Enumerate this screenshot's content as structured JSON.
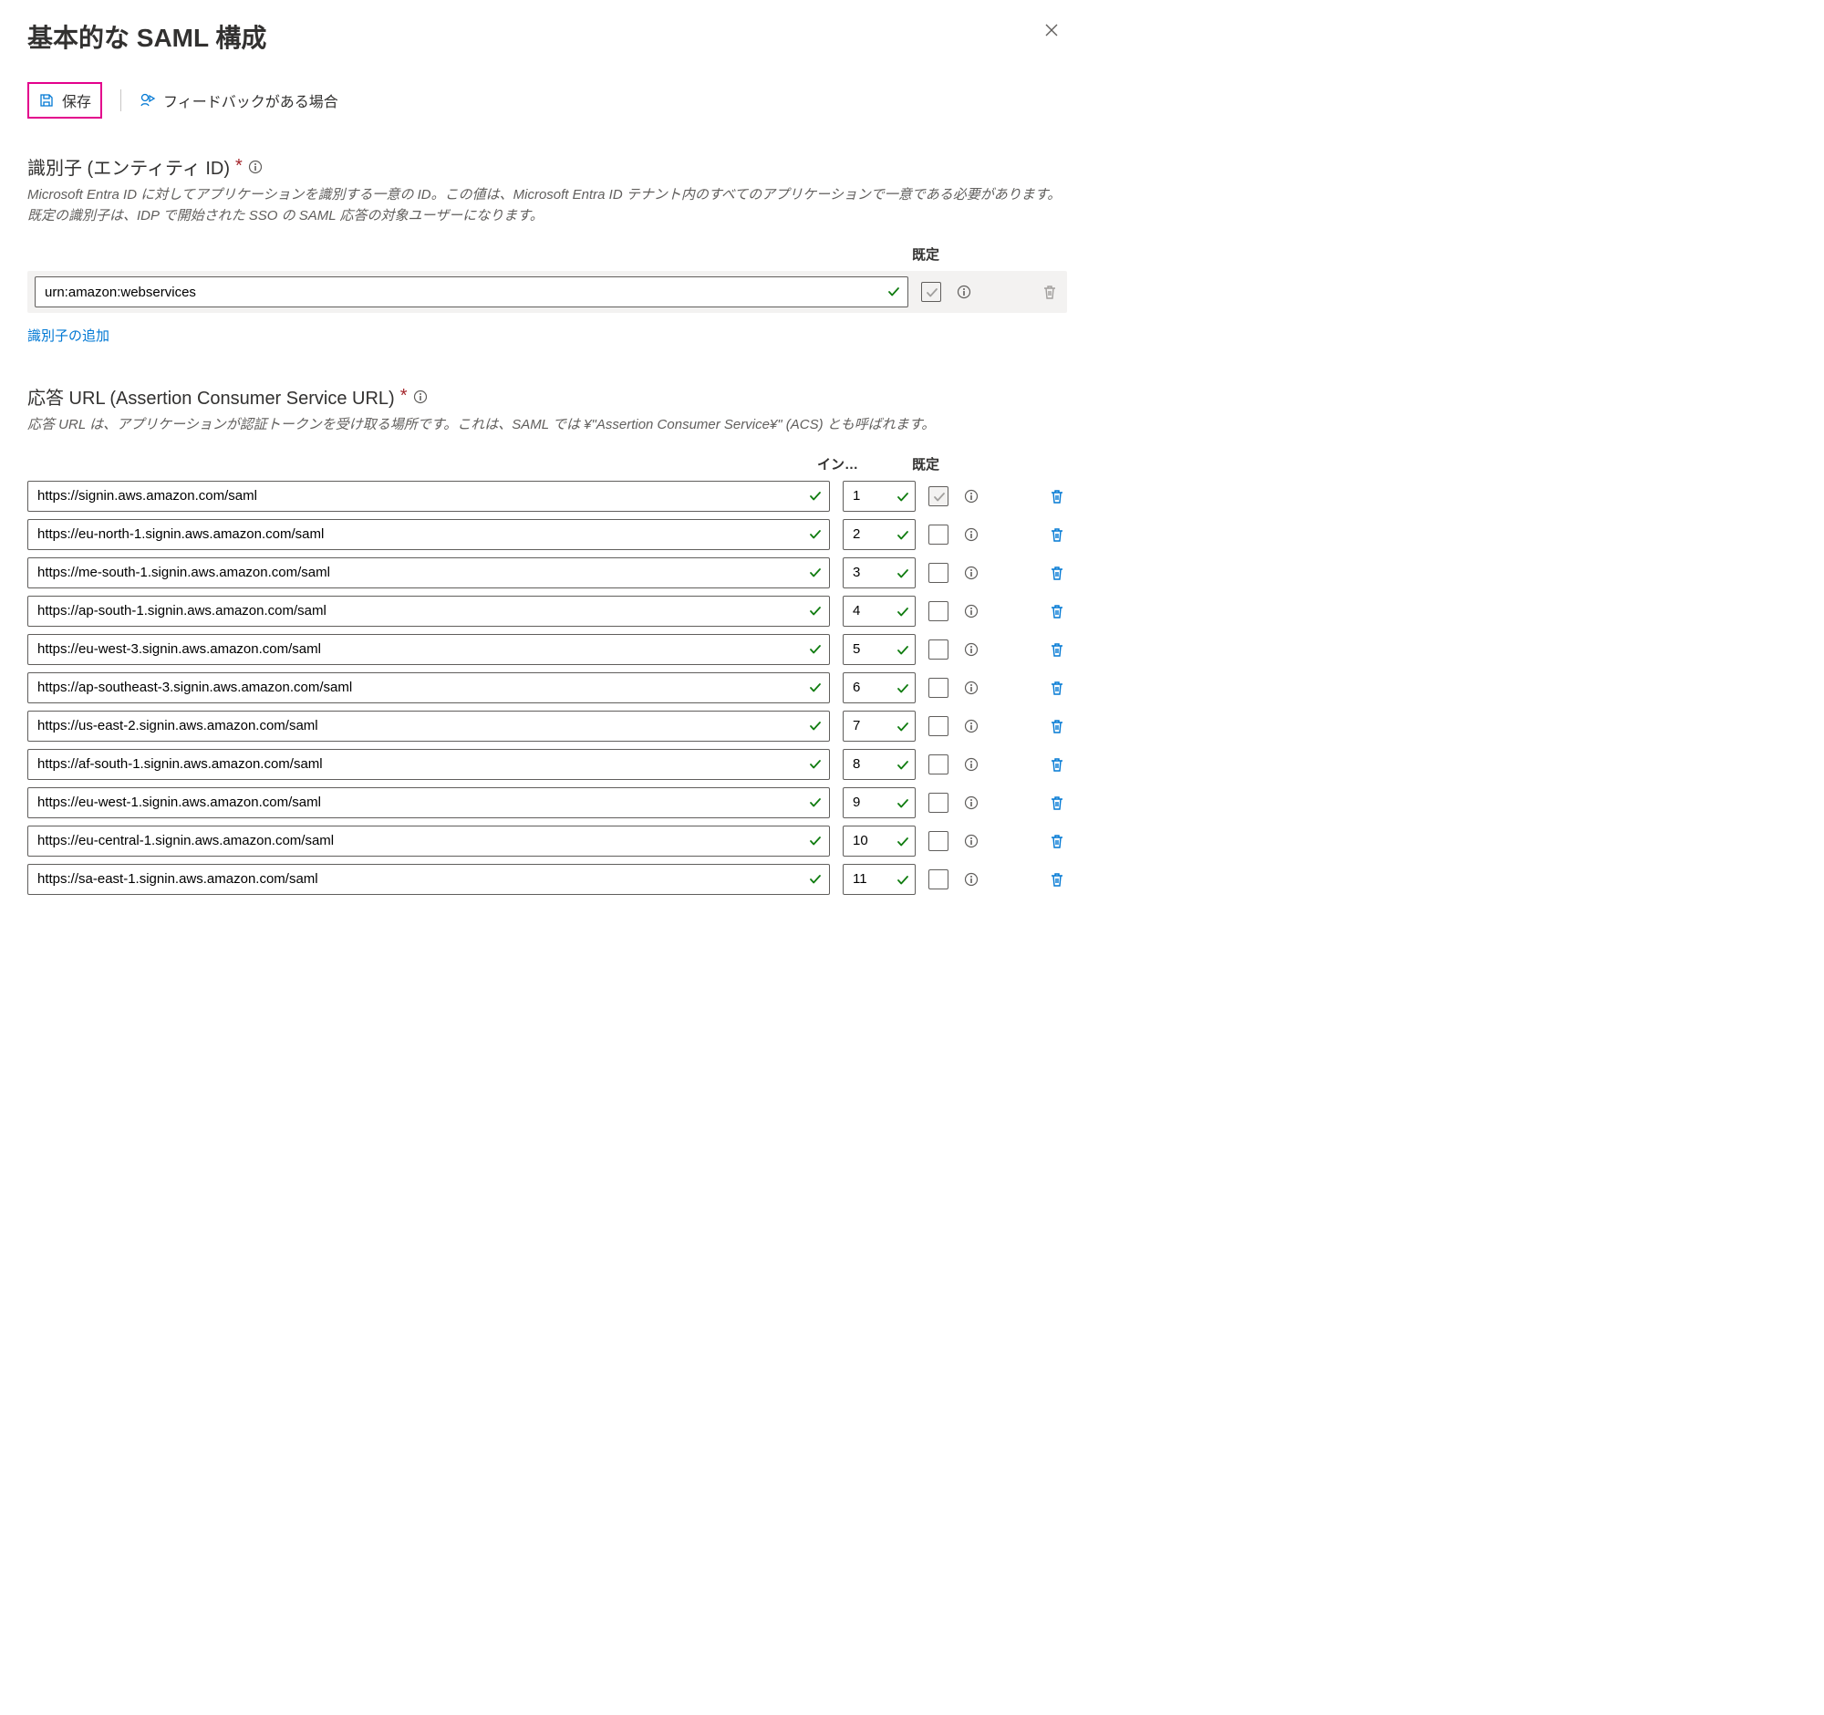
{
  "header": {
    "title": "基本的な SAML 構成"
  },
  "toolbar": {
    "save_label": "保存",
    "feedback_label": "フィードバックがある場合"
  },
  "identifier": {
    "title": "識別子 (エンティティ ID)",
    "desc": "Microsoft Entra ID に対してアプリケーションを識別する一意の ID。この値は、Microsoft Entra ID テナント内のすべてのアプリケーションで一意である必要があります。既定の識別子は、IDP で開始された SSO の SAML 応答の対象ユーザーになります。",
    "default_col": "既定",
    "value": "urn:amazon:webservices",
    "add_link": "識別子の追加"
  },
  "reply": {
    "title": "応答 URL (Assertion Consumer Service URL)",
    "desc": "応答 URL は、アプリケーションが認証トークンを受け取る場所です。これは、SAML では ¥\"Assertion Consumer Service¥\" (ACS) とも呼ばれます。",
    "index_col": "イン…",
    "default_col": "既定",
    "rows": [
      {
        "url": "https://signin.aws.amazon.com/saml",
        "index": "1",
        "default": true
      },
      {
        "url": "https://eu-north-1.signin.aws.amazon.com/saml",
        "index": "2",
        "default": false
      },
      {
        "url": "https://me-south-1.signin.aws.amazon.com/saml",
        "index": "3",
        "default": false
      },
      {
        "url": "https://ap-south-1.signin.aws.amazon.com/saml",
        "index": "4",
        "default": false
      },
      {
        "url": "https://eu-west-3.signin.aws.amazon.com/saml",
        "index": "5",
        "default": false
      },
      {
        "url": "https://ap-southeast-3.signin.aws.amazon.com/saml",
        "index": "6",
        "default": false
      },
      {
        "url": "https://us-east-2.signin.aws.amazon.com/saml",
        "index": "7",
        "default": false
      },
      {
        "url": "https://af-south-1.signin.aws.amazon.com/saml",
        "index": "8",
        "default": false
      },
      {
        "url": "https://eu-west-1.signin.aws.amazon.com/saml",
        "index": "9",
        "default": false
      },
      {
        "url": "https://eu-central-1.signin.aws.amazon.com/saml",
        "index": "10",
        "default": false
      },
      {
        "url": "https://sa-east-1.signin.aws.amazon.com/saml",
        "index": "11",
        "default": false
      }
    ]
  }
}
